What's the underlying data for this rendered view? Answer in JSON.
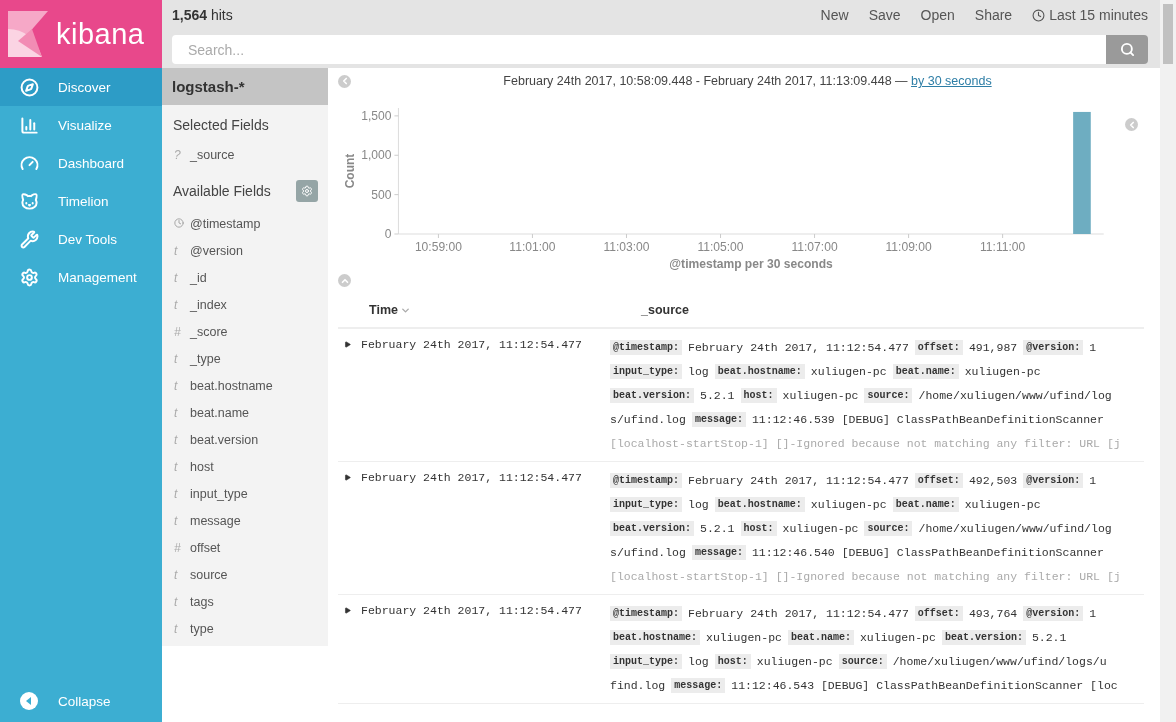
{
  "sidebar": {
    "logo": "kibana",
    "items": [
      {
        "label": "Discover",
        "selected": true
      },
      {
        "label": "Visualize",
        "selected": false
      },
      {
        "label": "Dashboard",
        "selected": false
      },
      {
        "label": "Timelion",
        "selected": false
      },
      {
        "label": "Dev Tools",
        "selected": false
      },
      {
        "label": "Management",
        "selected": false
      }
    ],
    "collapse": "Collapse"
  },
  "top_bar": {
    "hits_count": "1,564",
    "hits_label": "hits",
    "menu": [
      "New",
      "Save",
      "Open",
      "Share"
    ],
    "time_range": "Last 15 minutes",
    "search": {
      "placeholder": "Search..."
    }
  },
  "field_list": {
    "index_pattern": "logstash-*",
    "selected_title": "Selected Fields",
    "selected_fields": [
      {
        "kind": "glyph",
        "glyph": "?",
        "name": "_source"
      }
    ],
    "available_title": "Available Fields",
    "available_fields": [
      {
        "kind": "clock",
        "name": "@timestamp"
      },
      {
        "kind": "glyph",
        "glyph": "t",
        "name": "@version"
      },
      {
        "kind": "glyph",
        "glyph": "t",
        "name": "_id"
      },
      {
        "kind": "glyph",
        "glyph": "t",
        "name": "_index"
      },
      {
        "kind": "glyph",
        "glyph": "#",
        "name": "_score"
      },
      {
        "kind": "glyph",
        "glyph": "t",
        "name": "_type"
      },
      {
        "kind": "glyph",
        "glyph": "t",
        "name": "beat.hostname"
      },
      {
        "kind": "glyph",
        "glyph": "t",
        "name": "beat.name"
      },
      {
        "kind": "glyph",
        "glyph": "t",
        "name": "beat.version"
      },
      {
        "kind": "glyph",
        "glyph": "t",
        "name": "host"
      },
      {
        "kind": "glyph",
        "glyph": "t",
        "name": "input_type"
      },
      {
        "kind": "glyph",
        "glyph": "t",
        "name": "message"
      },
      {
        "kind": "glyph",
        "glyph": "#",
        "name": "offset"
      },
      {
        "kind": "glyph",
        "glyph": "t",
        "name": "source"
      },
      {
        "kind": "glyph",
        "glyph": "t",
        "name": "tags"
      },
      {
        "kind": "glyph",
        "glyph": "t",
        "name": "type"
      }
    ]
  },
  "histogram": {
    "range": "February 24th 2017, 10:58:09.448 - February 24th 2017, 11:13:09.448 —",
    "interval_link": "by 30 seconds",
    "chart_data": {
      "type": "bar",
      "xlabel": "@timestamp per 30 seconds",
      "ylabel": "Count",
      "categories": [
        null,
        null,
        "10:59:00",
        null,
        null,
        null,
        "11:01:00",
        null,
        null,
        null,
        "11:03:00",
        null,
        null,
        null,
        "11:05:00",
        null,
        null,
        null,
        "11:07:00",
        null,
        null,
        null,
        "11:09:00",
        null,
        null,
        null,
        "11:11:00",
        null,
        null,
        null
      ],
      "values": [
        0,
        0,
        0,
        0,
        0,
        0,
        0,
        0,
        0,
        0,
        0,
        0,
        0,
        0,
        0,
        0,
        0,
        0,
        0,
        0,
        0,
        0,
        0,
        0,
        0,
        0,
        0,
        0,
        0,
        1550
      ],
      "ylim": [
        0,
        1600
      ],
      "yticks": [
        {
          "value": 0,
          "label": "0"
        },
        {
          "value": 500,
          "label": "500"
        },
        {
          "value": 1000,
          "label": "1,000"
        },
        {
          "value": 1500,
          "label": "1,500"
        }
      ]
    }
  },
  "table": {
    "columns": [
      {
        "label": "Time",
        "sorted": true
      },
      {
        "label": "_source",
        "sorted": false
      }
    ],
    "rows": [
      {
        "time": "February 24th 2017, 11:12:54.477",
        "lines": [
          {
            "faded": false,
            "parts": [
              {
                "kind": "key",
                "text": "@timestamp:"
              },
              {
                "kind": "value",
                "text": "February 24th 2017, 11:12:54.477"
              },
              {
                "kind": "key",
                "text": "offset:"
              },
              {
                "kind": "value",
                "text": "491,987"
              },
              {
                "kind": "key",
                "text": "@version:"
              },
              {
                "kind": "value",
                "text": "1"
              }
            ]
          },
          {
            "faded": false,
            "parts": [
              {
                "kind": "key",
                "text": "input_type:"
              },
              {
                "kind": "value",
                "text": "log"
              },
              {
                "kind": "key",
                "text": "beat.hostname:"
              },
              {
                "kind": "value",
                "text": "xuliugen-pc"
              },
              {
                "kind": "key",
                "text": "beat.name:"
              },
              {
                "kind": "value",
                "text": "xuliugen-pc"
              }
            ]
          },
          {
            "faded": false,
            "parts": [
              {
                "kind": "key",
                "text": "beat.version:"
              },
              {
                "kind": "value",
                "text": "5.2.1"
              },
              {
                "kind": "key",
                "text": "host:"
              },
              {
                "kind": "value",
                "text": "xuliugen-pc"
              },
              {
                "kind": "key",
                "text": "source:"
              },
              {
                "kind": "value",
                "text": "/home/xuliugen/www/ufind/log"
              }
            ]
          },
          {
            "faded": false,
            "parts": [
              {
                "kind": "value",
                "text": "s/ufind.log"
              },
              {
                "kind": "key",
                "text": "message:"
              },
              {
                "kind": "value",
                "text": "11:12:46.539 [DEBUG] ClassPathBeanDefinitionScanner"
              }
            ]
          },
          {
            "faded": true,
            "parts": [
              {
                "kind": "value",
                "text": "[localhost-startStop-1] []-Ignored because not matching any filter: URL [j"
              }
            ]
          }
        ]
      },
      {
        "time": "February 24th 2017, 11:12:54.477",
        "lines": [
          {
            "faded": false,
            "parts": [
              {
                "kind": "key",
                "text": "@timestamp:"
              },
              {
                "kind": "value",
                "text": "February 24th 2017, 11:12:54.477"
              },
              {
                "kind": "key",
                "text": "offset:"
              },
              {
                "kind": "value",
                "text": "492,503"
              },
              {
                "kind": "key",
                "text": "@version:"
              },
              {
                "kind": "value",
                "text": "1"
              }
            ]
          },
          {
            "faded": false,
            "parts": [
              {
                "kind": "key",
                "text": "input_type:"
              },
              {
                "kind": "value",
                "text": "log"
              },
              {
                "kind": "key",
                "text": "beat.hostname:"
              },
              {
                "kind": "value",
                "text": "xuliugen-pc"
              },
              {
                "kind": "key",
                "text": "beat.name:"
              },
              {
                "kind": "value",
                "text": "xuliugen-pc"
              }
            ]
          },
          {
            "faded": false,
            "parts": [
              {
                "kind": "key",
                "text": "beat.version:"
              },
              {
                "kind": "value",
                "text": "5.2.1"
              },
              {
                "kind": "key",
                "text": "host:"
              },
              {
                "kind": "value",
                "text": "xuliugen-pc"
              },
              {
                "kind": "key",
                "text": "source:"
              },
              {
                "kind": "value",
                "text": "/home/xuliugen/www/ufind/log"
              }
            ]
          },
          {
            "faded": false,
            "parts": [
              {
                "kind": "value",
                "text": "s/ufind.log"
              },
              {
                "kind": "key",
                "text": "message:"
              },
              {
                "kind": "value",
                "text": "11:12:46.540 [DEBUG] ClassPathBeanDefinitionScanner"
              }
            ]
          },
          {
            "faded": true,
            "parts": [
              {
                "kind": "value",
                "text": "[localhost-startStop-1] []-Ignored because not matching any filter: URL [j"
              }
            ]
          }
        ]
      },
      {
        "time": "February 24th 2017, 11:12:54.477",
        "lines": [
          {
            "faded": false,
            "parts": [
              {
                "kind": "key",
                "text": "@timestamp:"
              },
              {
                "kind": "value",
                "text": "February 24th 2017, 11:12:54.477"
              },
              {
                "kind": "key",
                "text": "offset:"
              },
              {
                "kind": "value",
                "text": "493,764"
              },
              {
                "kind": "key",
                "text": "@version:"
              },
              {
                "kind": "value",
                "text": "1"
              }
            ]
          },
          {
            "faded": false,
            "parts": [
              {
                "kind": "key",
                "text": "beat.hostname:"
              },
              {
                "kind": "value",
                "text": "xuliugen-pc"
              },
              {
                "kind": "key",
                "text": "beat.name:"
              },
              {
                "kind": "value",
                "text": "xuliugen-pc"
              },
              {
                "kind": "key",
                "text": "beat.version:"
              },
              {
                "kind": "value",
                "text": "5.2.1"
              }
            ]
          },
          {
            "faded": false,
            "parts": [
              {
                "kind": "key",
                "text": "input_type:"
              },
              {
                "kind": "value",
                "text": "log"
              },
              {
                "kind": "key",
                "text": "host:"
              },
              {
                "kind": "value",
                "text": "xuliugen-pc"
              },
              {
                "kind": "key",
                "text": "source:"
              },
              {
                "kind": "value",
                "text": "/home/xuliugen/www/ufind/logs/u"
              }
            ]
          },
          {
            "faded": false,
            "parts": [
              {
                "kind": "value",
                "text": "find.log"
              },
              {
                "kind": "key",
                "text": "message:"
              },
              {
                "kind": "value",
                "text": "11:12:46.543 [DEBUG] ClassPathBeanDefinitionScanner [loc"
              }
            ]
          }
        ]
      }
    ]
  }
}
